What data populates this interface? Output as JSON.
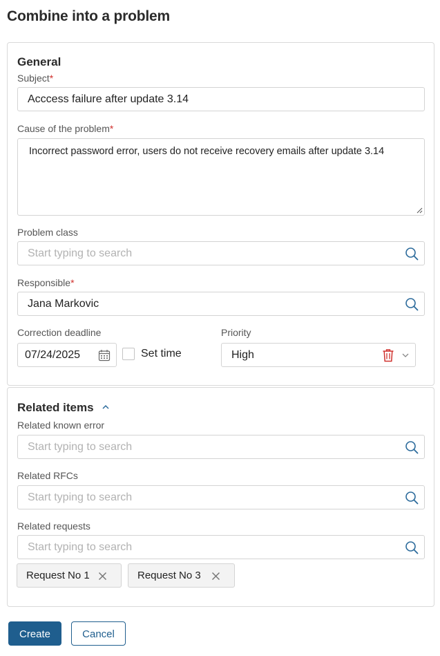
{
  "page": {
    "title": "Combine into a problem"
  },
  "general": {
    "section_title": "General",
    "subject": {
      "label": "Subject",
      "required_mark": "*",
      "value": "Acccess failure after update 3.14"
    },
    "cause": {
      "label": "Cause of the problem",
      "required_mark": "*",
      "value": "Incorrect password error, users do not receive recovery emails after update 3.14"
    },
    "problem_class": {
      "label": "Problem class",
      "placeholder": "Start typing to search"
    },
    "responsible": {
      "label": "Responsible",
      "required_mark": "*",
      "value": "Jana Markovic"
    },
    "deadline": {
      "label": "Correction deadline",
      "value": "07/24/2025",
      "set_time_label": "Set time",
      "set_time_checked": false
    },
    "priority": {
      "label": "Priority",
      "value": "High"
    }
  },
  "related": {
    "section_title": "Related items",
    "known_error": {
      "label": "Related known error",
      "placeholder": "Start typing to search"
    },
    "rfcs": {
      "label": "Related RFCs",
      "placeholder": "Start typing to search"
    },
    "requests": {
      "label": "Related requests",
      "placeholder": "Start typing to search",
      "chips": [
        "Request No 1",
        "Request No 3"
      ]
    }
  },
  "actions": {
    "create_label": "Create",
    "cancel_label": "Cancel"
  },
  "colors": {
    "accent": "#1f5e8e",
    "required": "#d0312d",
    "delete": "#d0312d",
    "icon": "#2b6a9b"
  }
}
